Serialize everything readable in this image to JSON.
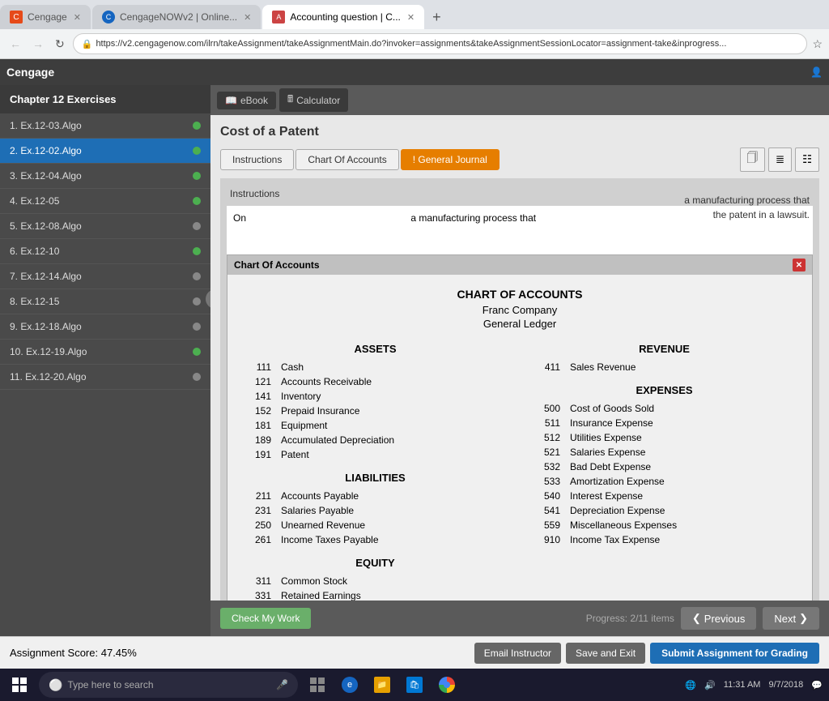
{
  "browser": {
    "tabs": [
      {
        "label": "Cengage",
        "active": false,
        "favicon": "C"
      },
      {
        "label": "CengageNOWv2 | Online...",
        "active": false,
        "favicon": "C"
      },
      {
        "label": "Accounting question | C...",
        "active": true,
        "favicon": "C"
      }
    ],
    "url": "https://v2.cengagenow.com/ilrn/takeAssignment/takeAssignmentMain.do?invoker=assignments&takeAssignmentSessionLocator=assignment-take&inprogress...",
    "secure_label": "Secure"
  },
  "app": {
    "logo": "Cengage"
  },
  "tool_tabs": [
    {
      "label": "eBook",
      "icon": "📖",
      "active": false
    },
    {
      "label": "Calculator",
      "icon": "🖩",
      "active": false
    }
  ],
  "sidebar": {
    "title": "Chapter 12 Exercises",
    "items": [
      {
        "label": "1. Ex.12-03.Algo",
        "dot": "green",
        "active": false
      },
      {
        "label": "2. Ex.12-02.Algo",
        "dot": "green",
        "active": true
      },
      {
        "label": "3. Ex.12-04.Algo",
        "dot": "green",
        "active": false
      },
      {
        "label": "4. Ex.12-05",
        "dot": "green",
        "active": false
      },
      {
        "label": "5. Ex.12-08.Algo",
        "dot": "gray",
        "active": false
      },
      {
        "label": "6. Ex.12-10",
        "dot": "green",
        "active": false
      },
      {
        "label": "7. Ex.12-14.Algo",
        "dot": "gray",
        "active": false
      },
      {
        "label": "8. Ex.12-15",
        "dot": "gray",
        "active": false
      },
      {
        "label": "9. Ex.12-18.Algo",
        "dot": "gray",
        "active": false
      },
      {
        "label": "10. Ex.12-19.Algo",
        "dot": "green",
        "active": false
      },
      {
        "label": "11. Ex.12-20.Algo",
        "dot": "gray",
        "active": false
      }
    ]
  },
  "problem": {
    "title": "Cost of a Patent",
    "tabs": [
      {
        "label": "Instructions",
        "active": false
      },
      {
        "label": "Chart Of Accounts",
        "active": false
      },
      {
        "label": "General Journal",
        "active": false,
        "highlight": "orange"
      }
    ],
    "icon_tabs": [
      "page",
      "list",
      "grid"
    ]
  },
  "instructions": {
    "label": "Instructions",
    "text": "On"
  },
  "coa": {
    "title": "Chart Of Accounts",
    "main_title": "CHART OF ACCOUNTS",
    "company": "Franc Company",
    "ledger": "General Ledger",
    "sections": {
      "assets": {
        "title": "ASSETS",
        "items": [
          {
            "num": "111",
            "name": "Cash"
          },
          {
            "num": "121",
            "name": "Accounts Receivable"
          },
          {
            "num": "141",
            "name": "Inventory"
          },
          {
            "num": "152",
            "name": "Prepaid Insurance"
          },
          {
            "num": "181",
            "name": "Equipment"
          },
          {
            "num": "189",
            "name": "Accumulated Depreciation"
          },
          {
            "num": "191",
            "name": "Patent"
          }
        ]
      },
      "liabilities": {
        "title": "LIABILITIES",
        "items": [
          {
            "num": "211",
            "name": "Accounts Payable"
          },
          {
            "num": "231",
            "name": "Salaries Payable"
          },
          {
            "num": "250",
            "name": "Unearned Revenue"
          },
          {
            "num": "261",
            "name": "Income Taxes Payable"
          }
        ]
      },
      "equity": {
        "title": "EQUITY",
        "items": [
          {
            "num": "311",
            "name": "Common Stock"
          },
          {
            "num": "331",
            "name": "Retained Earnings"
          }
        ]
      },
      "revenue": {
        "title": "REVENUE",
        "items": [
          {
            "num": "411",
            "name": "Sales Revenue"
          }
        ]
      },
      "expenses": {
        "title": "EXPENSES",
        "items": [
          {
            "num": "500",
            "name": "Cost of Goods Sold"
          },
          {
            "num": "511",
            "name": "Insurance Expense"
          },
          {
            "num": "512",
            "name": "Utilities Expense"
          },
          {
            "num": "521",
            "name": "Salaries Expense"
          },
          {
            "num": "532",
            "name": "Bad Debt Expense"
          },
          {
            "num": "533",
            "name": "Amortization Expense"
          },
          {
            "num": "540",
            "name": "Interest Expense"
          },
          {
            "num": "541",
            "name": "Depreciation Expense"
          },
          {
            "num": "559",
            "name": "Miscellaneous Expenses"
          },
          {
            "num": "910",
            "name": "Income Tax Expense"
          }
        ]
      }
    },
    "desc_suffix": "a manufacturing process that the patent in a lawsuit."
  },
  "bottom": {
    "check_work": "Check My Work",
    "previous": "Previous",
    "next": "Next",
    "progress": "Progress: 2/11 items"
  },
  "action_bar": {
    "score_label": "Assignment Score:",
    "score_value": "47.45%",
    "email_instructor": "Email Instructor",
    "save_and_exit": "Save and Exit",
    "submit": "Submit Assignment for Grading"
  },
  "taskbar": {
    "search_placeholder": "Type here to search",
    "time": "11:31 AM",
    "date": "9/7/2018"
  }
}
